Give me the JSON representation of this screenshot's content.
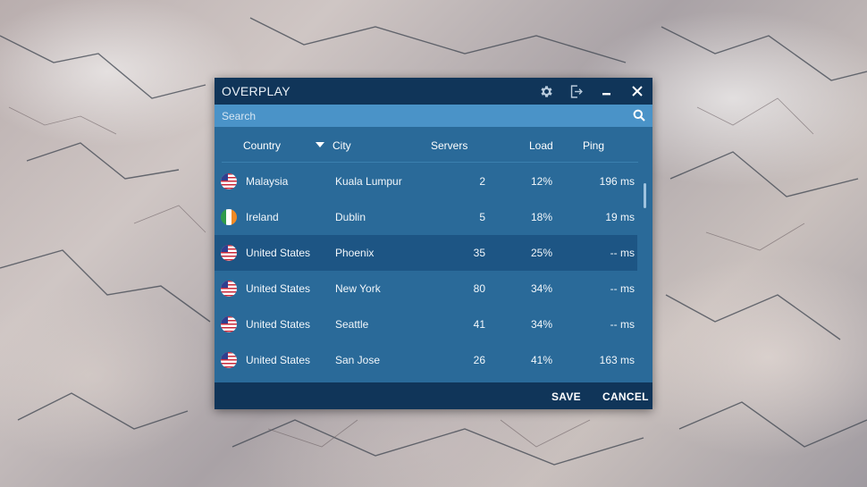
{
  "window": {
    "title": "OVERPLAY",
    "icons": [
      "gear-icon",
      "logout-icon",
      "minimize-icon",
      "close-icon"
    ]
  },
  "search": {
    "placeholder": "Search",
    "value": ""
  },
  "table": {
    "columns": {
      "country": "Country",
      "city": "City",
      "servers": "Servers",
      "load": "Load",
      "ping": "Ping"
    },
    "rows": [
      {
        "flag": "us-flag",
        "country": "Malaysia",
        "city": "Kuala Lumpur",
        "servers": "2",
        "load": "12%",
        "ping": "196 ms",
        "selected": false
      },
      {
        "flag": "ie-flag",
        "country": "Ireland",
        "city": "Dublin",
        "servers": "5",
        "load": "18%",
        "ping": "19 ms",
        "selected": false
      },
      {
        "flag": "us-flag",
        "country": "United States",
        "city": "Phoenix",
        "servers": "35",
        "load": "25%",
        "ping": "-- ms",
        "selected": true
      },
      {
        "flag": "us-flag",
        "country": "United States",
        "city": "New York",
        "servers": "80",
        "load": "34%",
        "ping": "-- ms",
        "selected": false
      },
      {
        "flag": "us-flag",
        "country": "United States",
        "city": "Seattle",
        "servers": "41",
        "load": "34%",
        "ping": "-- ms",
        "selected": false
      },
      {
        "flag": "us-flag",
        "country": "United States",
        "city": "San Jose",
        "servers": "26",
        "load": "41%",
        "ping": "163 ms",
        "selected": false
      }
    ]
  },
  "footer": {
    "save_label": "SAVE",
    "cancel_label": "CANCEL"
  },
  "colors": {
    "titlebar": "#103559",
    "body": "#2a6a99",
    "search": "#4a93c8",
    "selected_row": "#1d5584"
  }
}
